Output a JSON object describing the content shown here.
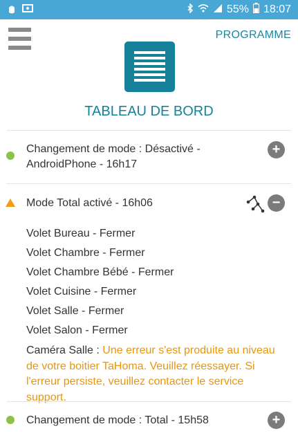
{
  "status_bar": {
    "battery_percent": "55%",
    "time": "18:07",
    "icons": [
      "notification-icon",
      "gallery-icon",
      "bluetooth-icon",
      "wifi-icon",
      "signal-icon",
      "battery-icon"
    ]
  },
  "header": {
    "programme_label": "PROGRAMME",
    "title": "TABLEAU DE BORD",
    "logo_icon": "document-icon"
  },
  "events": [
    {
      "text": "Changement de mode : Désactivé - AndroidPhone - 16h17",
      "status": "success",
      "action_icon": "plus-icon"
    },
    {
      "text": "Mode Total activé - 16h06",
      "status": "warning",
      "action_icon": "minus-icon",
      "details": [
        "Volet Bureau - Fermer",
        "Volet Chambre - Fermer",
        "Volet Chambre Bébé - Fermer",
        "Volet Cuisine - Fermer",
        "Volet Salle - Fermer",
        "Volet Salon - Fermer"
      ],
      "error_device": "Caméra Salle : ",
      "error_message": "Une erreur s'est produite au niveau de votre boitier TaHoma. Veuillez réessayer. Si l'erreur persiste, veuillez contacter le service support."
    },
    {
      "text": "Changement de mode : Total - 15h58",
      "status": "success",
      "action_icon": "plus-icon"
    }
  ],
  "colors": {
    "status_bar": "#49a7d6",
    "accent": "#16819a",
    "success": "#8bc34a",
    "warning": "#f39c12",
    "error_text": "#e8960c",
    "button_gray": "#7b7b7b"
  }
}
